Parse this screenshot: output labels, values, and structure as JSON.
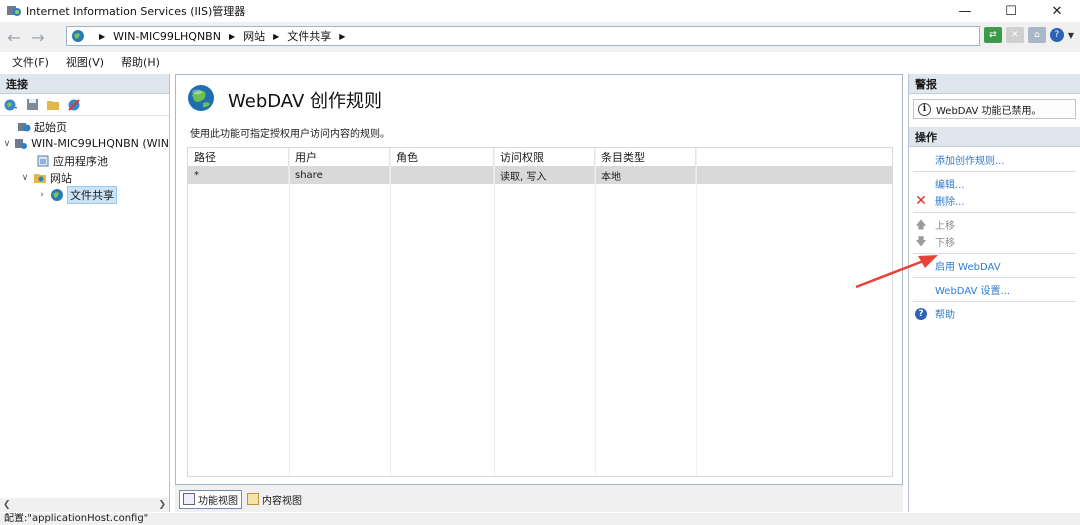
{
  "window": {
    "title": "Internet Information Services (IIS)管理器",
    "controls": {
      "minimize": "—",
      "maximize": "☐",
      "close": "✕"
    }
  },
  "address": {
    "breadcrumbs": [
      "WIN-MIC99LHQNBN",
      "网站",
      "文件共享"
    ]
  },
  "menu": {
    "file": "文件(F)",
    "view": "视图(V)",
    "help": "帮助(H)"
  },
  "connections": {
    "header": "连接",
    "tree": [
      {
        "label": "起始页",
        "icon": "start-page-icon",
        "level": 0
      },
      {
        "label": "WIN-MIC99LHQNBN (WIN",
        "icon": "server-icon",
        "level": 0,
        "expanded": true
      },
      {
        "label": "应用程序池",
        "icon": "app-pool-icon",
        "level": 1
      },
      {
        "label": "网站",
        "icon": "sites-folder-icon",
        "level": 1,
        "expanded": true
      },
      {
        "label": "文件共享",
        "icon": "globe-icon",
        "level": 2,
        "selected": true
      }
    ]
  },
  "feature": {
    "title": "WebDAV 创作规则",
    "description": "使用此功能可指定授权用户访问内容的规则。",
    "columns": [
      "路径",
      "用户",
      "角色",
      "访问权限",
      "条目类型"
    ],
    "rows": [
      [
        "*",
        "share",
        "",
        "读取, 写入",
        "本地"
      ]
    ],
    "view_tabs": {
      "features": "功能视图",
      "content": "内容视图"
    }
  },
  "actions": {
    "alerts_header": "警报",
    "alert_text": "WebDAV 功能已禁用。",
    "actions_header": "操作",
    "items": {
      "add_rule": "添加创作规则...",
      "edit": "编辑...",
      "remove": "删除...",
      "move_up": "上移",
      "move_down": "下移",
      "enable_webdav": "启用 WebDAV",
      "webdav_settings": "WebDAV 设置...",
      "help": "帮助"
    }
  },
  "statusbar": {
    "text": "配置:\"applicationHost.config\""
  },
  "colors": {
    "link": "#2f7bd0",
    "annotation_arrow": "#e8423a"
  }
}
